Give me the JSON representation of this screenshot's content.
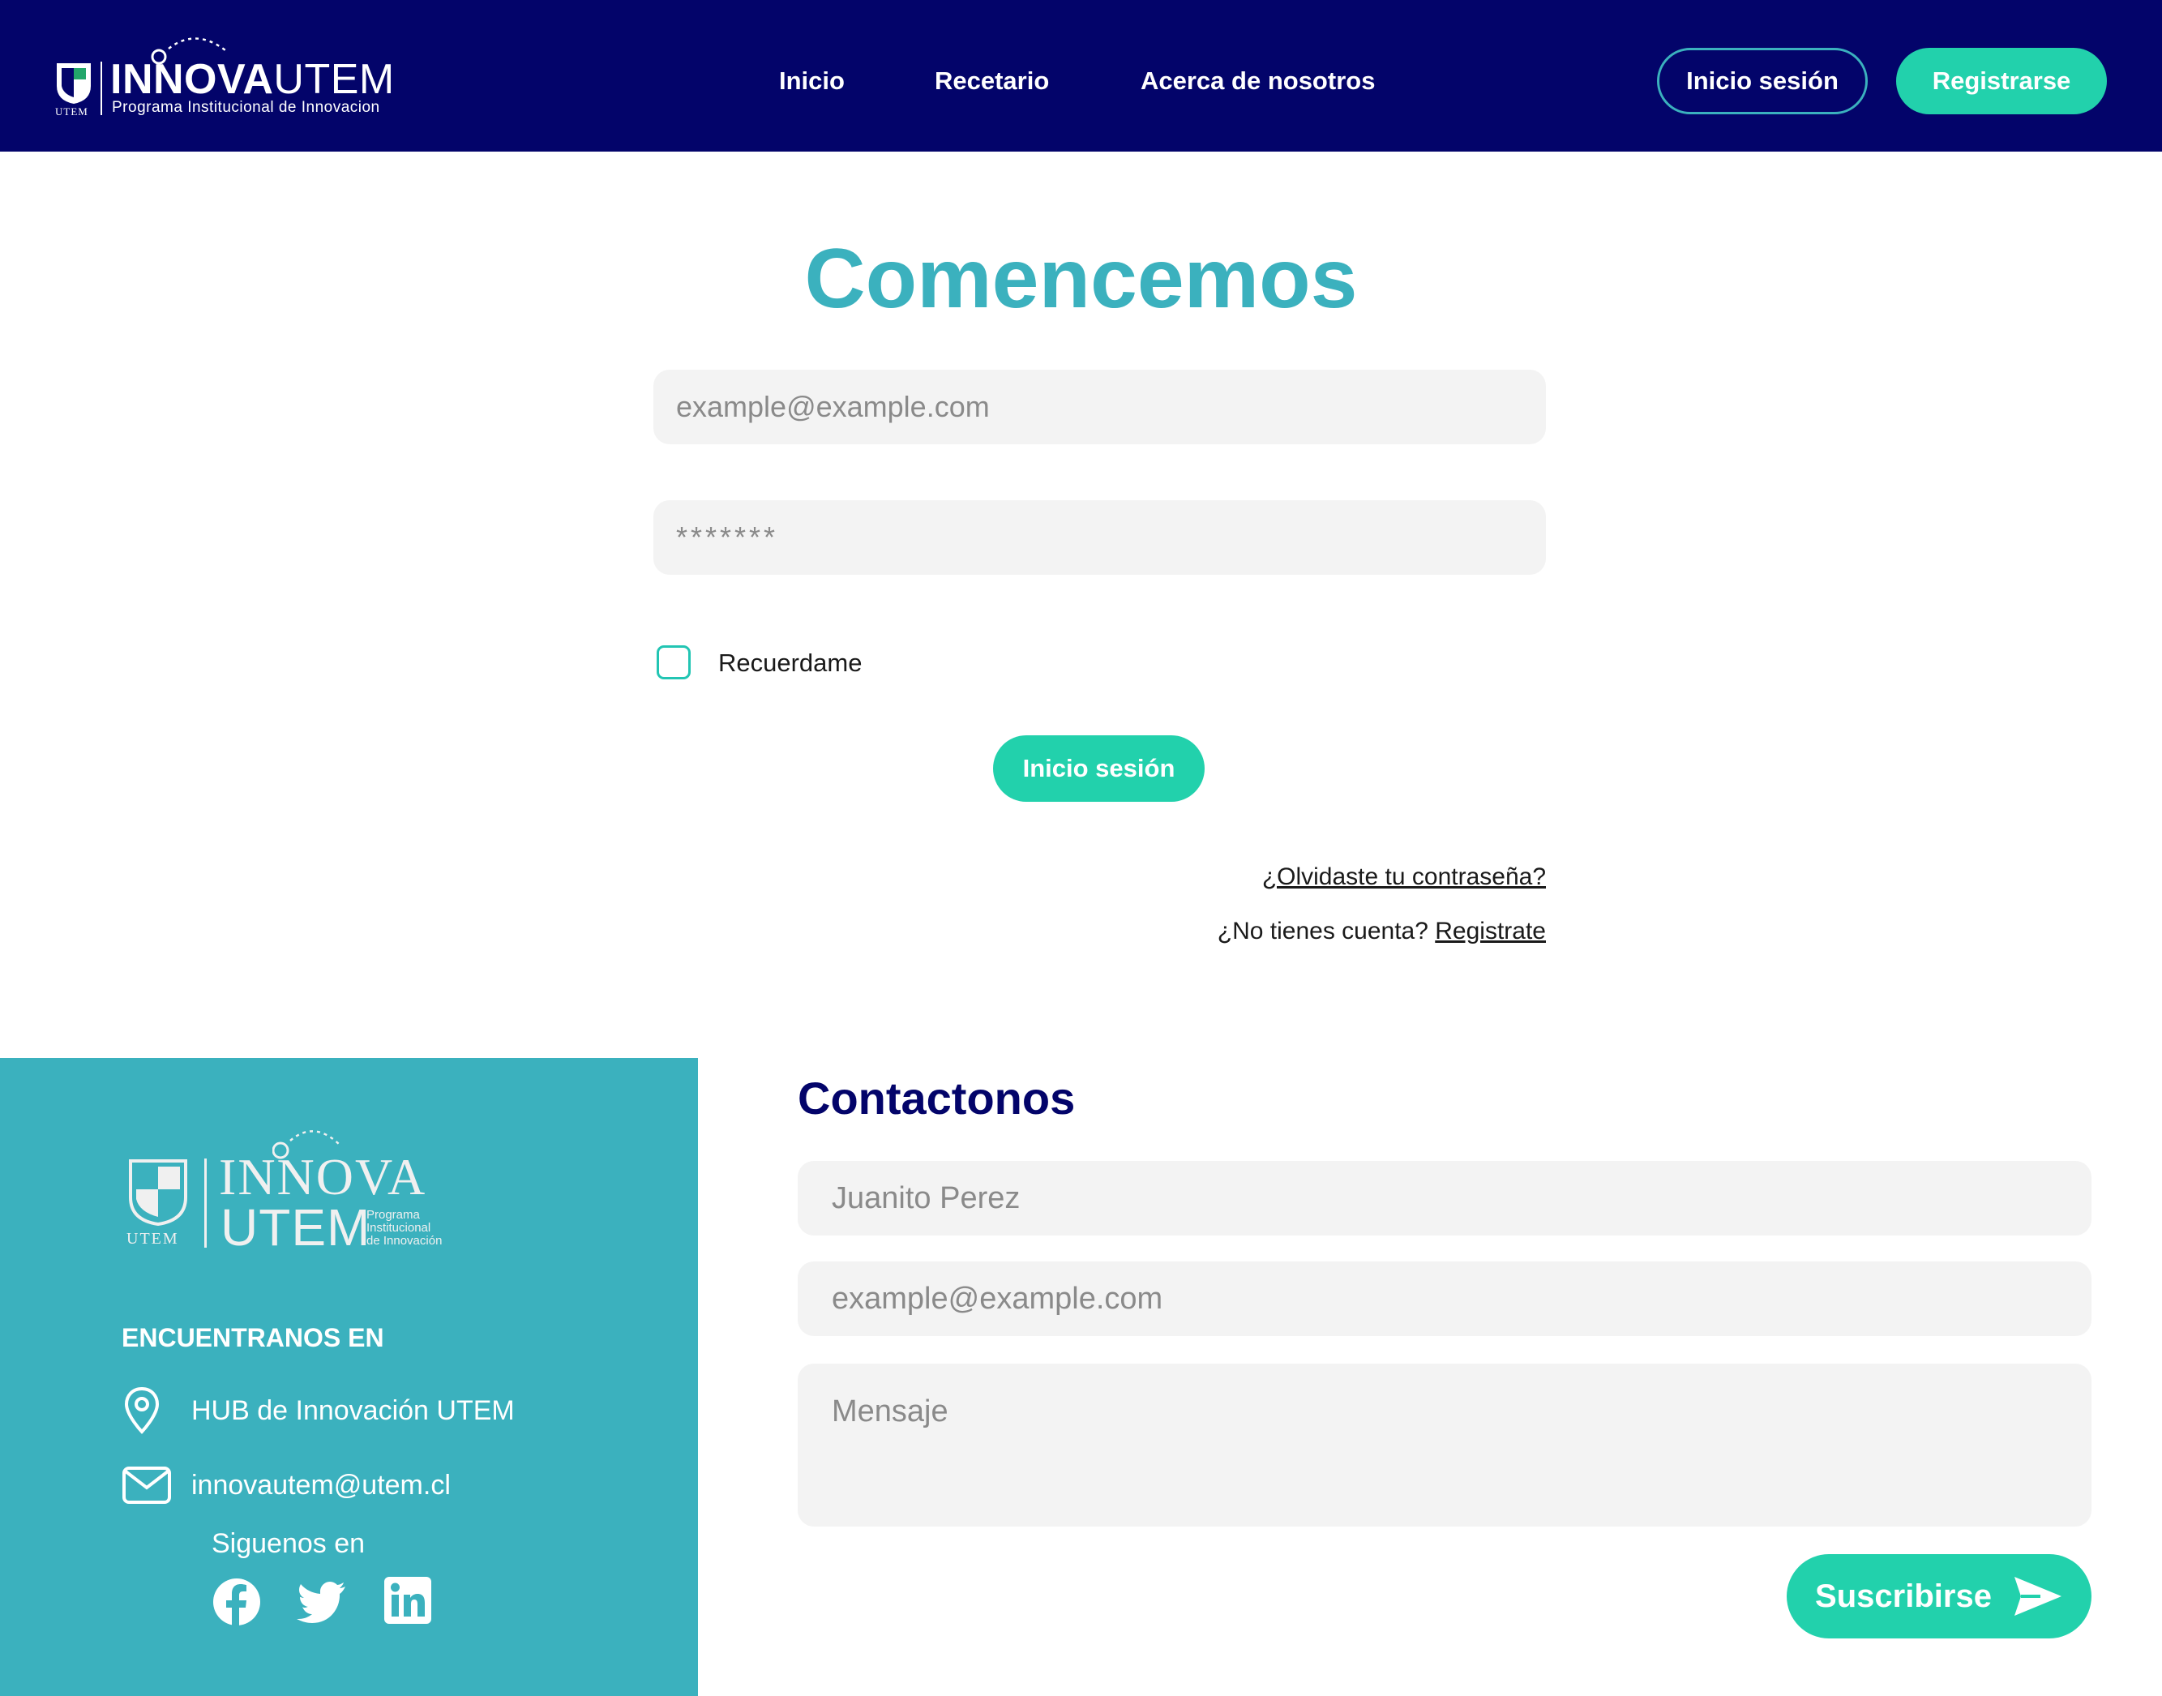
{
  "header": {
    "logo": {
      "brand_bold": "INNOVA",
      "brand_light": "UTEM",
      "tagline": "Programa Institucional de Innovacion",
      "shield_caption": "UTEM"
    },
    "nav": [
      {
        "label": "Inicio"
      },
      {
        "label": "Recetario"
      },
      {
        "label": "Acerca de nosotros"
      }
    ],
    "login_button": "Inicio sesión",
    "register_button": "Registrarse"
  },
  "login": {
    "title": "Comencemos",
    "email_placeholder": "example@example.com",
    "password_placeholder": "*******",
    "remember_label": "Recuerdame",
    "remember_checked": false,
    "submit_button": "Inicio sesión",
    "forgot_link": "¿Olvidaste tu contraseña?",
    "no_account_text": "¿No tienes cuenta?",
    "register_link": "Registrate"
  },
  "footer": {
    "logo": {
      "innova": "INNOVA",
      "utem": "UTEM",
      "tagline_lines": [
        "Programa",
        "Institucional",
        "de Innovación"
      ],
      "shield_caption": "UTEM"
    },
    "find_us_heading": "ENCUENTRANOS EN",
    "address": "HUB de Innovación UTEM",
    "email": "innovautem@utem.cl",
    "follow_label": "Siguenos en",
    "socials": [
      "facebook-icon",
      "twitter-icon",
      "linkedin-icon"
    ]
  },
  "contact": {
    "title": "Contactonos",
    "name_placeholder": "Juanito Perez",
    "email_placeholder": "example@example.com",
    "message_placeholder": "Mensaje",
    "submit_button": "Suscribirse"
  },
  "colors": {
    "header_bg": "#03046a",
    "accent_teal": "#3bb1be",
    "accent_green": "#22d1ac",
    "title_navy": "#03046a",
    "input_bg": "#f3f3f3"
  }
}
